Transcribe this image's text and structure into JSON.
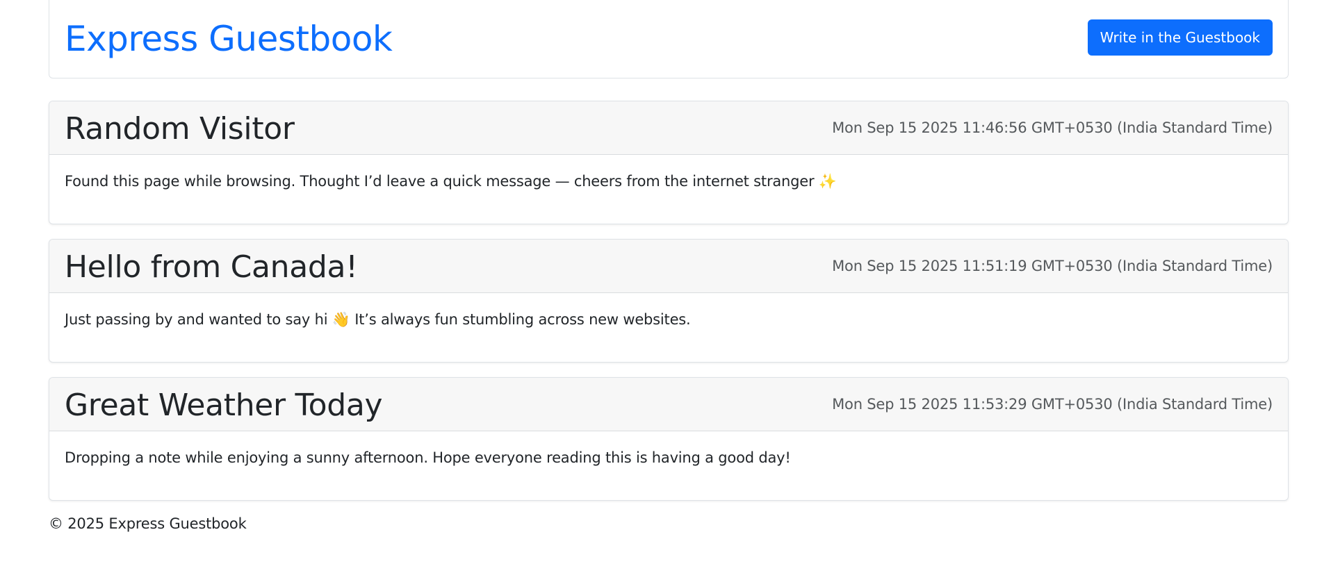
{
  "header": {
    "title": "Express Guestbook",
    "write_button_label": "Write in the Guestbook"
  },
  "entries": [
    {
      "title": "Random Visitor",
      "date": "Mon Sep 15 2025 11:46:56 GMT+0530 (India Standard Time)",
      "message": "Found this page while browsing. Thought I’d leave a quick message — cheers from the internet stranger ✨"
    },
    {
      "title": "Hello from Canada!",
      "date": "Mon Sep 15 2025 11:51:19 GMT+0530 (India Standard Time)",
      "message": "Just passing by and wanted to say hi 👋 It’s always fun stumbling across new websites."
    },
    {
      "title": "Great Weather Today",
      "date": "Mon Sep 15 2025 11:53:29 GMT+0530 (India Standard Time)",
      "message": "Dropping a note while enjoying a sunny afternoon. Hope everyone reading this is having a good day!"
    }
  ],
  "footer": {
    "text": "© 2025 Express Guestbook"
  },
  "colors": {
    "brand": "#0d6efd",
    "text": "#212529",
    "muted": "#55595c",
    "card_header_bg": "#f7f7f7",
    "border": "#dee2e6"
  }
}
